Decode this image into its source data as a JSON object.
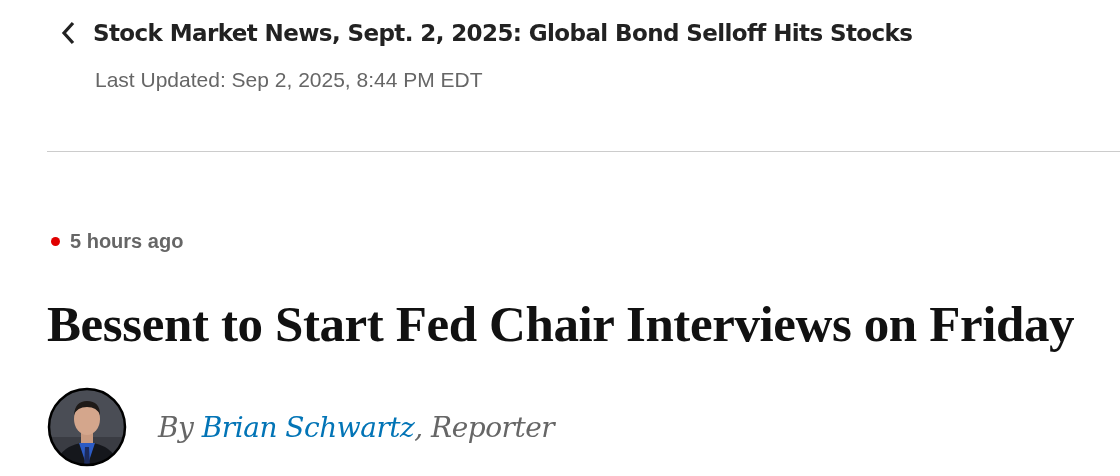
{
  "header": {
    "title": "Stock Market News, Sept. 2, 2025: Global Bond Selloff Hits Stocks",
    "last_updated": "Last Updated: Sep 2, 2025, 8:44 PM EDT"
  },
  "article": {
    "live": true,
    "timestamp": "5 hours ago",
    "headline": "Bessent to Start Fed Chair Interviews on Friday",
    "byline": {
      "prefix": "By",
      "author": "Brian Schwartz",
      "suffix": ", Reporter"
    }
  }
}
